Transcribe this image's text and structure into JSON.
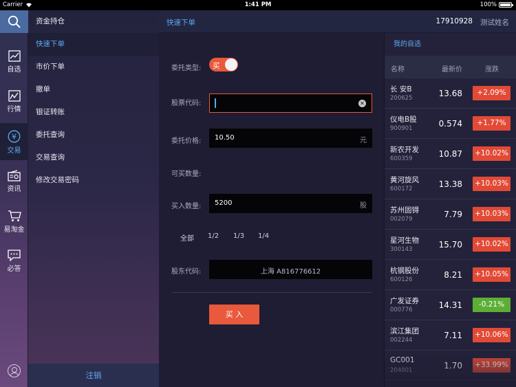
{
  "status_bar": {
    "carrier": "Carrier",
    "time": "1:41 PM",
    "battery": "100%"
  },
  "rail": {
    "items": [
      {
        "label": "自选"
      },
      {
        "label": "行情"
      },
      {
        "label": "交易"
      },
      {
        "label": "资讯"
      },
      {
        "label": "易淘金"
      },
      {
        "label": "必答"
      }
    ]
  },
  "submenu": {
    "items": [
      "资金持仓",
      "快速下单",
      "市价下单",
      "撤单",
      "银证转账",
      "委托查询",
      "交易查询",
      "修改交易密码"
    ],
    "active_index": 1,
    "logout": "注销"
  },
  "header": {
    "title": "快速下单",
    "account": "17910928",
    "username": "测试姓名"
  },
  "form": {
    "order_type_label": "委托类型:",
    "order_type_value": "买",
    "stock_code_label": "股票代码:",
    "stock_code_value": "",
    "price_label": "委托价格:",
    "price_value": "10.50",
    "price_unit": "元",
    "available_label": "可买数量:",
    "quantity_label": "买入数量:",
    "quantity_value": "5200",
    "quantity_unit": "股",
    "fractions": [
      "全部",
      "1/2",
      "1/3",
      "1/4"
    ],
    "holder_label": "股东代码:",
    "holder_value": "上海 A816776612",
    "submit": "买 入"
  },
  "watchlist": {
    "title": "我的自选",
    "headers": {
      "name": "名称",
      "price": "最新价",
      "change": "涨跌"
    },
    "rows": [
      {
        "name": "长  安B",
        "code": "200625",
        "price": "13.68",
        "change": "+2.09%",
        "dir": "up"
      },
      {
        "name": "仪电B股",
        "code": "900901",
        "price": "0.574",
        "change": "+1.77%",
        "dir": "up"
      },
      {
        "name": "新农开发",
        "code": "600359",
        "price": "10.87",
        "change": "+10.02%",
        "dir": "up"
      },
      {
        "name": "黄河旋风",
        "code": "600172",
        "price": "13.38",
        "change": "+10.03%",
        "dir": "up"
      },
      {
        "name": "苏州固锝",
        "code": "002079",
        "price": "7.79",
        "change": "+10.03%",
        "dir": "up"
      },
      {
        "name": "星河生物",
        "code": "300143",
        "price": "15.70",
        "change": "+10.02%",
        "dir": "up"
      },
      {
        "name": "杭钢股份",
        "code": "600126",
        "price": "8.21",
        "change": "+10.05%",
        "dir": "up"
      },
      {
        "name": "广发证券",
        "code": "000776",
        "price": "14.31",
        "change": "-0.21%",
        "dir": "down"
      },
      {
        "name": "滨江集团",
        "code": "002244",
        "price": "7.11",
        "change": "+10.06%",
        "dir": "up"
      },
      {
        "name": "GC001",
        "code": "204001",
        "price": "1.70",
        "change": "+33.99%",
        "dir": "up"
      }
    ],
    "colors": {
      "up": "#e24a36",
      "down": "#5cae35"
    }
  }
}
